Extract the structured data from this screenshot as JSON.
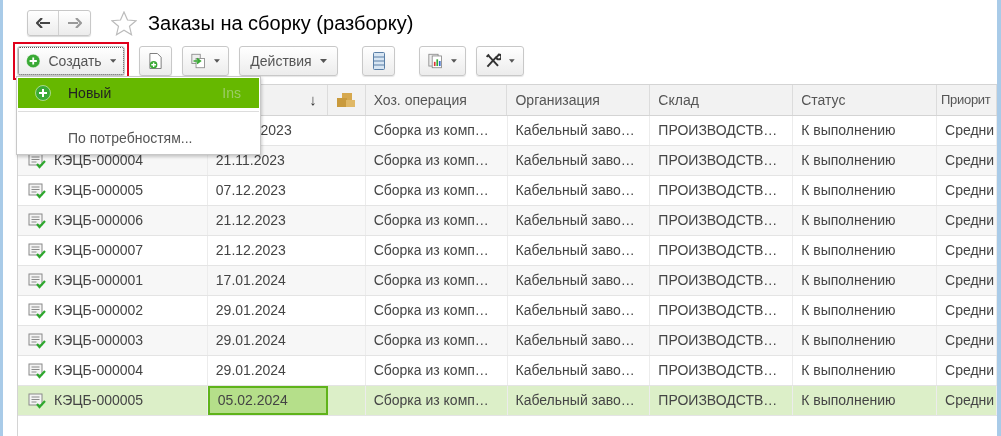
{
  "window": {
    "title": "Заказы на сборку (разборку)",
    "favorite": false
  },
  "toolbar": {
    "create_button": {
      "label": "Создать",
      "highlighted": true
    },
    "actions_button": {
      "label": "Действия"
    }
  },
  "create_menu": [
    {
      "label": "Новый",
      "shortcut": "Ins",
      "selected": true
    },
    {
      "label": "По потребностям...",
      "selected": false
    }
  ],
  "table": {
    "sort_indicator": "↓",
    "columns": [
      "Хоз. операция",
      "Организация",
      "Склад",
      "Статус",
      "Приорит"
    ],
    "rows": [
      {
        "date": "2023",
        "operation": "Сборка из комп…",
        "organization": "Кабельный заво…",
        "warehouse": "ПРОИЗВОДСТВ…",
        "status": "К выполнению",
        "priority": "Средни",
        "selected": false
      },
      {
        "number": "КЭЦБ-000004",
        "date": "21.11.2023",
        "operation": "Сборка из комп…",
        "organization": "Кабельный заво…",
        "warehouse": "ПРОИЗВОДСТВ…",
        "status": "К выполнению",
        "priority": "Средни",
        "selected": false
      },
      {
        "number": "КЭЦБ-000005",
        "date": "07.12.2023",
        "operation": "Сборка из комп…",
        "organization": "Кабельный заво…",
        "warehouse": "ПРОИЗВОДСТВ…",
        "status": "К выполнению",
        "priority": "Средни",
        "selected": false
      },
      {
        "number": "КЭЦБ-000006",
        "date": "21.12.2023",
        "operation": "Сборка из комп…",
        "organization": "Кабельный заво…",
        "warehouse": "ПРОИЗВОДСТВ…",
        "status": "К выполнению",
        "priority": "Средни",
        "selected": false
      },
      {
        "number": "КЭЦБ-000007",
        "date": "21.12.2023",
        "operation": "Сборка из комп…",
        "organization": "Кабельный заво…",
        "warehouse": "ПРОИЗВОДСТВ…",
        "status": "К выполнению",
        "priority": "Средни",
        "selected": false
      },
      {
        "number": "КЭЦБ-000001",
        "date": "17.01.2024",
        "operation": "Сборка из комп…",
        "organization": "Кабельный заво…",
        "warehouse": "ПРОИЗВОДСТВ…",
        "status": "К выполнению",
        "priority": "Средни",
        "selected": false
      },
      {
        "number": "КЭЦБ-000002",
        "date": "29.01.2024",
        "operation": "Сборка из комп…",
        "organization": "Кабельный заво…",
        "warehouse": "ПРОИЗВОДСТВ…",
        "status": "К выполнению",
        "priority": "Средни",
        "selected": false
      },
      {
        "number": "КЭЦБ-000003",
        "date": "29.01.2024",
        "operation": "Сборка из комп…",
        "organization": "Кабельный заво…",
        "warehouse": "ПРОИЗВОДСТВ…",
        "status": "К выполнению",
        "priority": "Средни",
        "selected": false
      },
      {
        "number": "КЭЦБ-000004",
        "date": "29.01.2024",
        "operation": "Сборка из комп…",
        "organization": "Кабельный заво…",
        "warehouse": "ПРОИЗВОДСТВ…",
        "status": "К выполнению",
        "priority": "Средни",
        "selected": false
      },
      {
        "number": "КЭЦБ-000005",
        "date": "05.02.2024",
        "operation": "Сборка из комп…",
        "organization": "Кабельный заво…",
        "warehouse": "ПРОИЗВОДСТВ…",
        "status": "К выполнению",
        "priority": "Средни",
        "selected": true
      }
    ]
  }
}
